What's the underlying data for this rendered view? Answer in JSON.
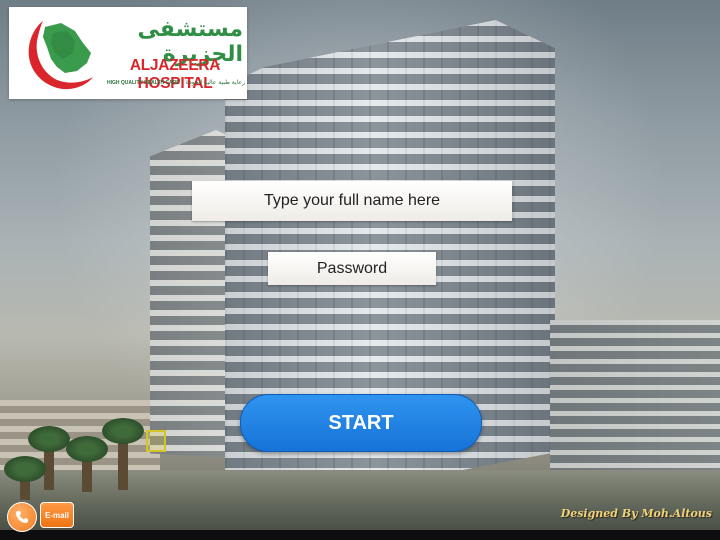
{
  "logo": {
    "arabic_name": "مستشفى الجزيرة",
    "english_name": "ALJAZEERA HOSPITAL",
    "tagline": "HIGH QUALITY HEALTH CARE",
    "tagline_arabic": "رعاية طبية عالية الجودة",
    "colors": {
      "green": "#2e8f45",
      "red": "#d9252b"
    }
  },
  "form": {
    "name_placeholder": "Type your full  name here",
    "password_placeholder": "Password",
    "start_label": "START",
    "start_color": "#1f82e4"
  },
  "footer": {
    "phone_icon": "phone-icon",
    "email_label": "E-mail",
    "credit": "Designed By Moh.Altous",
    "button_color": "#f28a2e"
  }
}
